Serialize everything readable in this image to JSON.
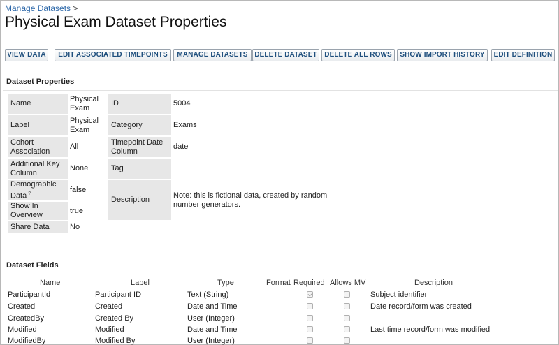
{
  "breadcrumb": {
    "link": "Manage Datasets",
    "separator": ">"
  },
  "page_title": "Physical Exam Dataset Properties",
  "toolbar": {
    "view_data": "VIEW DATA",
    "edit_timepoints": "EDIT ASSOCIATED TIMEPOINTS",
    "manage_datasets": "MANAGE DATASETS",
    "delete_dataset": "DELETE DATASET",
    "delete_all_rows": "DELETE ALL ROWS",
    "show_import_history": "SHOW IMPORT HISTORY",
    "edit_definition": "EDIT DEFINITION"
  },
  "dataset_properties": {
    "section_title": "Dataset Properties",
    "left": [
      {
        "label": "Name",
        "value": "Physical Exam"
      },
      {
        "label": "Label",
        "value": "Physical Exam"
      },
      {
        "label": "Cohort Association",
        "value": "All"
      },
      {
        "label": "Additional Key Column",
        "value": "None"
      },
      {
        "label": "Demographic Data",
        "help": "?",
        "value": "false"
      },
      {
        "label": "Show In Overview",
        "value": "true"
      },
      {
        "label": "Share Data",
        "value": "No"
      }
    ],
    "right": [
      {
        "label": "ID",
        "value": "5004"
      },
      {
        "label": "Category",
        "value": "Exams"
      },
      {
        "label": "Timepoint Date Column",
        "value": "date"
      },
      {
        "label": "Tag",
        "value": ""
      },
      {
        "label": "Description",
        "value": "Note: this is fictional data, created by random number generators."
      }
    ]
  },
  "dataset_fields": {
    "section_title": "Dataset Fields",
    "headers": {
      "name": "Name",
      "label": "Label",
      "type": "Type",
      "format": "Format",
      "required": "Required",
      "allows_mv": "Allows MV",
      "description": "Description"
    },
    "rows": [
      {
        "name": "ParticipantId",
        "label": "Participant ID",
        "type": "Text (String)",
        "required": true,
        "allows_mv": false,
        "description": "Subject identifier"
      },
      {
        "name": "Created",
        "label": "Created",
        "type": "Date and Time",
        "required": false,
        "allows_mv": false,
        "description": "Date record/form was created"
      },
      {
        "name": "CreatedBy",
        "label": "Created By",
        "type": "User (Integer)",
        "required": false,
        "allows_mv": false,
        "description": ""
      },
      {
        "name": "Modified",
        "label": "Modified",
        "type": "Date and Time",
        "required": false,
        "allows_mv": false,
        "description": "Last time record/form was modified"
      },
      {
        "name": "ModifiedBy",
        "label": "Modified By",
        "type": "User (Integer)",
        "required": false,
        "allows_mv": false,
        "description": ""
      }
    ]
  }
}
